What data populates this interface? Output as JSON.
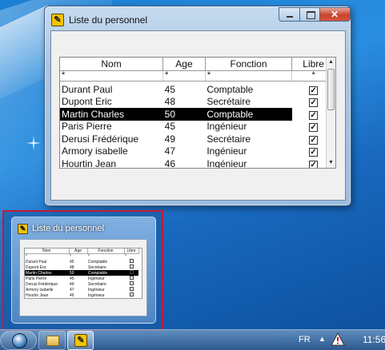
{
  "window": {
    "title": "Liste du personnel",
    "icon": "app-yellow-icon",
    "controls": [
      "minimize",
      "maximize",
      "close"
    ]
  },
  "grid": {
    "columns": [
      "Nom",
      "Age",
      "Fonction",
      "Libre"
    ],
    "filters": [
      "*",
      "*",
      "*",
      "*"
    ],
    "rows": [
      {
        "nom": "Durant Paul",
        "age": "45",
        "fonction": "Comptable",
        "libre": true
      },
      {
        "nom": "Dupont Eric",
        "age": "48",
        "fonction": "Secrétaire",
        "libre": true
      },
      {
        "nom": "Martin Charles",
        "age": "50",
        "fonction": "Comptable",
        "libre": true,
        "selected": true
      },
      {
        "nom": "Paris Pierre",
        "age": "45",
        "fonction": "Ingénieur",
        "libre": true
      },
      {
        "nom": "Derusi Frédérique",
        "age": "49",
        "fonction": "Secrétaire",
        "libre": true
      },
      {
        "nom": "Armory isabelle",
        "age": "47",
        "fonction": "Ingénieur",
        "libre": true
      },
      {
        "nom": "Hourtin  Jean",
        "age": "46",
        "fonction": "Ingénieur",
        "libre": true
      }
    ]
  },
  "preview": {
    "title": "Liste du personnel"
  },
  "taskbar": {
    "language": "FR",
    "clock": "11:56",
    "items": [
      "start-orb",
      "windows-explorer",
      "liste-du-personnel"
    ]
  },
  "colors": {
    "selected_row_bg": "#000000",
    "preview_border": "#c41a36"
  }
}
